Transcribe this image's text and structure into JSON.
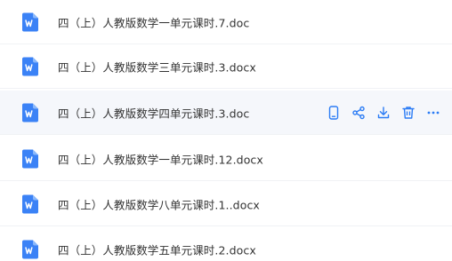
{
  "colors": {
    "icon_blue": "#3b82f6",
    "text": "#333333",
    "hover_row": "#f5f7fb",
    "action_blue": "#2b7cf5"
  },
  "files": [
    {
      "name": "四（上）人教版数学一单元课时.7.doc",
      "icon": "word-doc-icon"
    },
    {
      "name": "四（上）人教版数学三单元课时.3.docx",
      "icon": "word-doc-icon"
    },
    {
      "name": "四（上）人教版数学四单元课时.3.doc",
      "icon": "word-doc-icon"
    },
    {
      "name": "四（上）人教版数学一单元课时.12.docx",
      "icon": "word-doc-icon"
    },
    {
      "name": "四（上）人教版数学八单元课时.1..docx",
      "icon": "word-doc-icon"
    },
    {
      "name": "四（上）人教版数学五单元课时.2.docx",
      "icon": "word-doc-icon"
    }
  ],
  "row_actions": [
    "mobile-icon",
    "share-icon",
    "download-icon",
    "delete-icon",
    "more-icon"
  ]
}
